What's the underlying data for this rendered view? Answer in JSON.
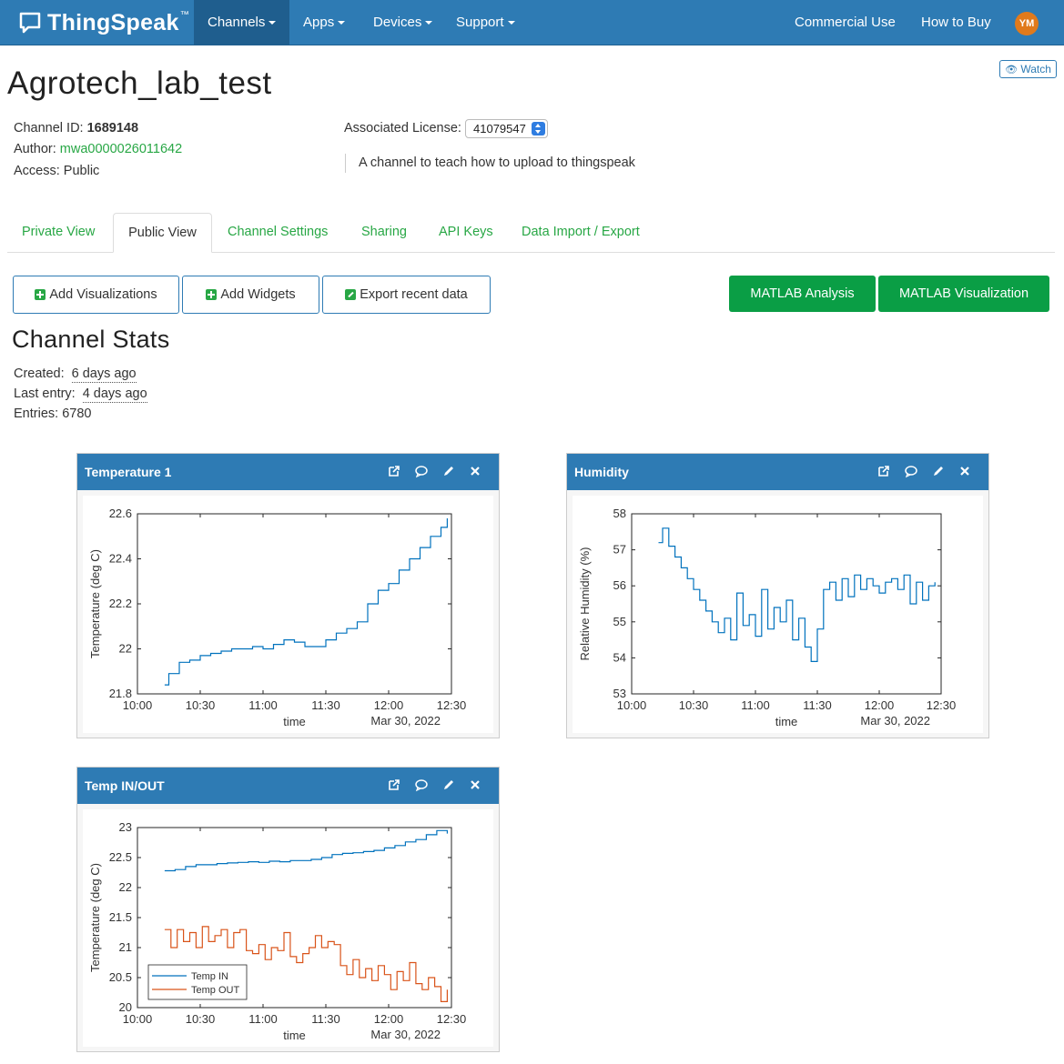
{
  "nav": {
    "brand": "ThingSpeak",
    "brand_tm": "™",
    "items": [
      {
        "label": "Channels",
        "dropdown": true,
        "active": true
      },
      {
        "label": "Apps",
        "dropdown": true
      },
      {
        "label": "Devices",
        "dropdown": true
      },
      {
        "label": "Support",
        "dropdown": true
      }
    ],
    "right": [
      {
        "label": "Commercial Use"
      },
      {
        "label": "How to Buy"
      }
    ],
    "avatar_initials": "YM"
  },
  "channel": {
    "title": "Agrotech_lab_test",
    "watch_label": "Watch",
    "id_label": "Channel ID:",
    "id": "1689148",
    "author_label": "Author:",
    "author": "mwa0000026011642",
    "access_label": "Access:",
    "access": "Public",
    "license_label": "Associated License:",
    "license": "41079547",
    "description": "A channel to teach how to upload to thingspeak"
  },
  "tabs": [
    "Private View",
    "Public View",
    "Channel Settings",
    "Sharing",
    "API Keys",
    "Data Import / Export"
  ],
  "active_tab": "Public View",
  "buttons": {
    "add_viz": "Add Visualizations",
    "add_widgets": "Add Widgets",
    "export": "Export recent data",
    "matlab_analysis": "MATLAB Analysis",
    "matlab_viz": "MATLAB Visualization"
  },
  "stats": {
    "title": "Channel Stats",
    "created_label": "Created:",
    "created": "6 days ago",
    "last_entry_label": "Last entry:",
    "last_entry": "4 days ago",
    "entries_label": "Entries:",
    "entries": "6780"
  },
  "widgets": [
    {
      "title": "Temperature 1"
    },
    {
      "title": "Humidity"
    },
    {
      "title": "Temp IN/OUT"
    }
  ],
  "colors": {
    "nav_bg": "#2e7bb4",
    "series_blue": "#0072bd",
    "series_orange": "#d95319",
    "green": "#28a745"
  },
  "chart_data": [
    {
      "type": "line",
      "ylabel": "Temperature (deg C)",
      "xlabel": "time",
      "date_label": "Mar 30, 2022",
      "xticks": [
        "10:00",
        "10:30",
        "11:00",
        "11:30",
        "12:00",
        "12:30"
      ],
      "yticks": [
        "21.8",
        "22",
        "22.2",
        "22.4",
        "22.6"
      ],
      "xlim": [
        "10:00",
        "12:30"
      ],
      "ylim": [
        21.8,
        22.6
      ],
      "series": [
        {
          "color": "#0072bd",
          "x": [
            "10:13",
            "10:15",
            "10:20",
            "10:25",
            "10:30",
            "10:35",
            "10:40",
            "10:45",
            "10:50",
            "10:55",
            "11:00",
            "11:05",
            "11:10",
            "11:15",
            "11:20",
            "11:25",
            "11:30",
            "11:35",
            "11:40",
            "11:45",
            "11:50",
            "11:55",
            "12:00",
            "12:05",
            "12:10",
            "12:15",
            "12:20",
            "12:25",
            "12:28"
          ],
          "values": [
            21.84,
            21.89,
            21.94,
            21.95,
            21.97,
            21.98,
            21.99,
            22.0,
            22.0,
            22.01,
            22.0,
            22.02,
            22.04,
            22.03,
            22.01,
            22.01,
            22.04,
            22.07,
            22.09,
            22.12,
            22.2,
            22.26,
            22.29,
            22.35,
            22.4,
            22.45,
            22.5,
            22.54,
            22.58
          ]
        }
      ]
    },
    {
      "type": "line",
      "ylabel": "Relative Humidity (%)",
      "xlabel": "time",
      "date_label": "Mar 30, 2022",
      "xticks": [
        "10:00",
        "10:30",
        "11:00",
        "11:30",
        "12:00",
        "12:30"
      ],
      "yticks": [
        "53",
        "54",
        "55",
        "56",
        "57",
        "58"
      ],
      "xlim": [
        "10:00",
        "12:30"
      ],
      "ylim": [
        53,
        58
      ],
      "series": [
        {
          "color": "#0072bd",
          "x": [
            "10:13",
            "10:15",
            "10:18",
            "10:21",
            "10:24",
            "10:27",
            "10:30",
            "10:33",
            "10:36",
            "10:39",
            "10:42",
            "10:45",
            "10:48",
            "10:51",
            "10:54",
            "10:57",
            "11:00",
            "11:03",
            "11:06",
            "11:09",
            "11:12",
            "11:15",
            "11:18",
            "11:21",
            "11:24",
            "11:27",
            "11:30",
            "11:33",
            "11:36",
            "11:39",
            "11:42",
            "11:45",
            "11:48",
            "11:51",
            "11:54",
            "11:57",
            "12:00",
            "12:03",
            "12:06",
            "12:09",
            "12:12",
            "12:15",
            "12:18",
            "12:21",
            "12:24",
            "12:27"
          ],
          "values": [
            57.2,
            57.6,
            57.1,
            56.8,
            56.5,
            56.2,
            55.9,
            55.6,
            55.3,
            55.0,
            54.7,
            55.1,
            54.5,
            55.8,
            54.9,
            55.2,
            54.6,
            55.9,
            54.8,
            55.4,
            55.0,
            55.6,
            54.5,
            55.1,
            54.3,
            53.9,
            54.8,
            55.9,
            56.1,
            55.6,
            56.2,
            55.7,
            56.3,
            55.9,
            56.2,
            56.0,
            55.8,
            56.1,
            56.2,
            55.9,
            56.3,
            55.5,
            56.1,
            55.6,
            56.0,
            56.1
          ]
        }
      ]
    },
    {
      "type": "line",
      "ylabel": "Temperature (deg C)",
      "xlabel": "time",
      "date_label": "Mar 30, 2022",
      "xticks": [
        "10:00",
        "10:30",
        "11:00",
        "11:30",
        "12:00",
        "12:30"
      ],
      "yticks": [
        "20",
        "20.5",
        "21",
        "21.5",
        "22",
        "22.5",
        "23"
      ],
      "xlim": [
        "10:00",
        "12:30"
      ],
      "ylim": [
        20,
        23
      ],
      "legend_position": "bottom-left",
      "series": [
        {
          "name": "Temp IN",
          "color": "#0072bd",
          "x": [
            "10:13",
            "10:18",
            "10:23",
            "10:28",
            "10:33",
            "10:38",
            "10:43",
            "10:48",
            "10:53",
            "10:58",
            "11:03",
            "11:08",
            "11:13",
            "11:18",
            "11:23",
            "11:28",
            "11:33",
            "11:38",
            "11:43",
            "11:48",
            "11:53",
            "11:58",
            "12:03",
            "12:08",
            "12:13",
            "12:18",
            "12:23",
            "12:28"
          ],
          "values": [
            22.28,
            22.3,
            22.35,
            22.38,
            22.38,
            22.4,
            22.41,
            22.42,
            22.43,
            22.42,
            22.44,
            22.43,
            22.45,
            22.45,
            22.47,
            22.5,
            22.55,
            22.57,
            22.58,
            22.6,
            22.62,
            22.66,
            22.7,
            22.76,
            22.8,
            22.88,
            22.95,
            22.9
          ]
        },
        {
          "name": "Temp OUT",
          "color": "#d95319",
          "x": [
            "10:13",
            "10:16",
            "10:19",
            "10:22",
            "10:25",
            "10:28",
            "10:31",
            "10:34",
            "10:37",
            "10:40",
            "10:43",
            "10:46",
            "10:49",
            "10:52",
            "10:55",
            "10:58",
            "11:01",
            "11:04",
            "11:07",
            "11:10",
            "11:13",
            "11:16",
            "11:19",
            "11:22",
            "11:25",
            "11:28",
            "11:31",
            "11:34",
            "11:37",
            "11:40",
            "11:43",
            "11:46",
            "11:49",
            "11:52",
            "11:55",
            "11:58",
            "12:01",
            "12:04",
            "12:07",
            "12:10",
            "12:13",
            "12:16",
            "12:19",
            "12:22",
            "12:25",
            "12:28"
          ],
          "values": [
            21.3,
            21.0,
            21.3,
            21.1,
            21.25,
            21.0,
            21.35,
            21.1,
            21.2,
            21.3,
            21.0,
            21.25,
            21.3,
            20.95,
            20.9,
            21.05,
            20.8,
            21.0,
            20.95,
            21.25,
            20.85,
            20.75,
            20.9,
            21.0,
            21.2,
            21.0,
            21.1,
            21.05,
            20.7,
            20.55,
            20.8,
            20.5,
            20.65,
            20.45,
            20.7,
            20.55,
            20.3,
            20.6,
            20.45,
            20.75,
            20.4,
            20.3,
            20.5,
            20.35,
            20.1,
            20.3
          ]
        }
      ]
    }
  ]
}
